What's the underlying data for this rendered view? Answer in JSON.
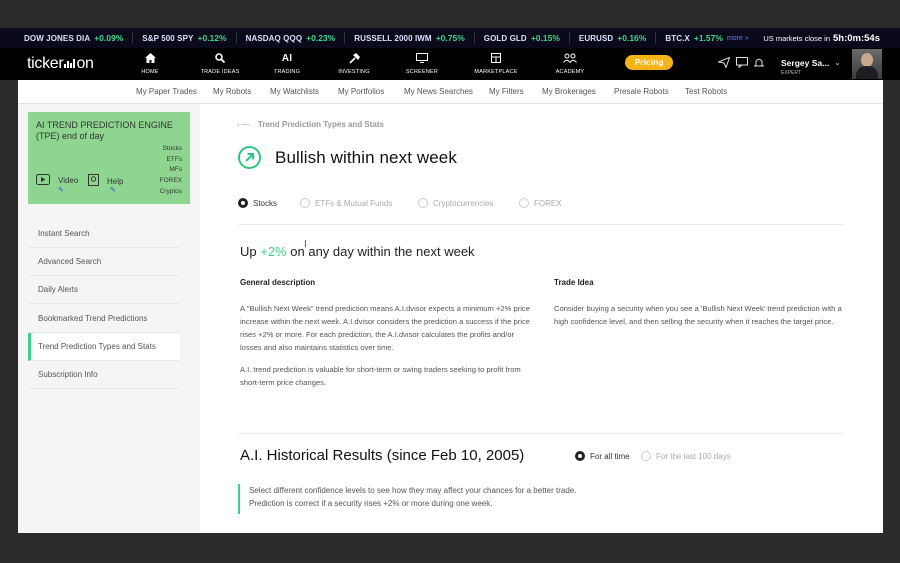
{
  "tickers": [
    {
      "name": "DOW JONES DIA",
      "change": "+0.09%"
    },
    {
      "name": "S&P 500 SPY",
      "change": "+0.12%"
    },
    {
      "name": "NASDAQ QQQ",
      "change": "+0.23%"
    },
    {
      "name": "RUSSELL 2000 IWM",
      "change": "+0.75%"
    },
    {
      "name": "GOLD GLD",
      "change": "+0.15%"
    },
    {
      "name": "EURUSD",
      "change": "+0.16%"
    },
    {
      "name": "BTC.X",
      "change": "+1.57%"
    }
  ],
  "ticker_more": "more »",
  "market_close": {
    "label": "US markets close in",
    "time": "5h:0m:54s"
  },
  "logo": {
    "left": "ticker",
    "right": "on"
  },
  "nav": [
    {
      "label": "HOME",
      "icon": "home-icon"
    },
    {
      "label": "TRADE IDEAS",
      "icon": "search-icon"
    },
    {
      "label": "TRADING",
      "icon": "ai-icon",
      "glyph": "AI"
    },
    {
      "label": "INVESTING",
      "icon": "hammer-icon"
    },
    {
      "label": "SCREENER",
      "icon": "monitor-icon"
    },
    {
      "label": "MARKETPLACE",
      "icon": "store-icon"
    },
    {
      "label": "ACADEMY",
      "icon": "people-icon"
    }
  ],
  "pricing_label": "Pricing",
  "user": {
    "name": "Sergey Sa...",
    "role": "EXPERT"
  },
  "subnav": [
    "My Paper Trades",
    "My Robots",
    "My Watchlists",
    "My Portfolios",
    "My News Searches",
    "My Filters",
    "My Brokerages",
    "Presale Robots",
    "Test Robots"
  ],
  "tpe": {
    "title": "AI TREND PREDICTION ENGINE (TPE) end of day",
    "assets": [
      "Stocks",
      "ETFs",
      "MFs",
      "FOREX",
      "Cryptos"
    ],
    "video_label": "Video",
    "help_label": "Help"
  },
  "sidebar": [
    {
      "label": "Instant Search"
    },
    {
      "label": "Advanced Search"
    },
    {
      "label": "Daily Alerts"
    },
    {
      "label": "Bookmarked Trend Predictions"
    },
    {
      "label": "Trend Prediction Types and Stats",
      "active": true
    },
    {
      "label": "Subscription Info"
    }
  ],
  "main": {
    "breadcrumb": "Trend Prediction Types and Stats",
    "title": "Bullish within next week",
    "asset_tabs": [
      {
        "label": "Stocks",
        "selected": true
      },
      {
        "label": "ETFs & Mutual Funds",
        "selected": false
      },
      {
        "label": "Cryptocurrencies",
        "selected": false
      },
      {
        "label": "FOREX",
        "selected": false
      }
    ],
    "headline_pre": "Up",
    "headline_value": "+2%",
    "headline_post": "on any day within the next week",
    "general_title": "General description",
    "general_p1": "A \"Bullish Next Week\" trend prediction means A.I.dvisor expects a minimum +2% price increase within the next week. A.I.dvisor considers the prediction a success if the price rises +2% or more. For each prediction, the A.I.dvisor calculates the profits and/or losses and also maintains statistics over time.",
    "general_p2": "A.I. trend prediction is valuable for short-term or swing traders seeking to profit from short-term price changes.",
    "trade_title": "Trade Idea",
    "trade_p": "Consider buying a security when you see a 'Bullish Next Week' trend prediction with a high confidence level, and then selling the security when it reaches the target price.",
    "hist_title": "A.I. Historical Results (since Feb 10, 2005)",
    "hist_options": [
      {
        "label": "For all time",
        "selected": true
      },
      {
        "label": "For the last 100 days",
        "selected": false
      }
    ],
    "note_l1": "Select different confidence levels to see how they may affect your chances for a better trade.",
    "note_l2": "Prediction is correct if a security rises +2% or more during one week."
  },
  "colors": {
    "accent": "#3fcf8e",
    "pricing": "#f7b316",
    "tpe_box": "#8ed68f",
    "positive": "#3fd48a"
  }
}
